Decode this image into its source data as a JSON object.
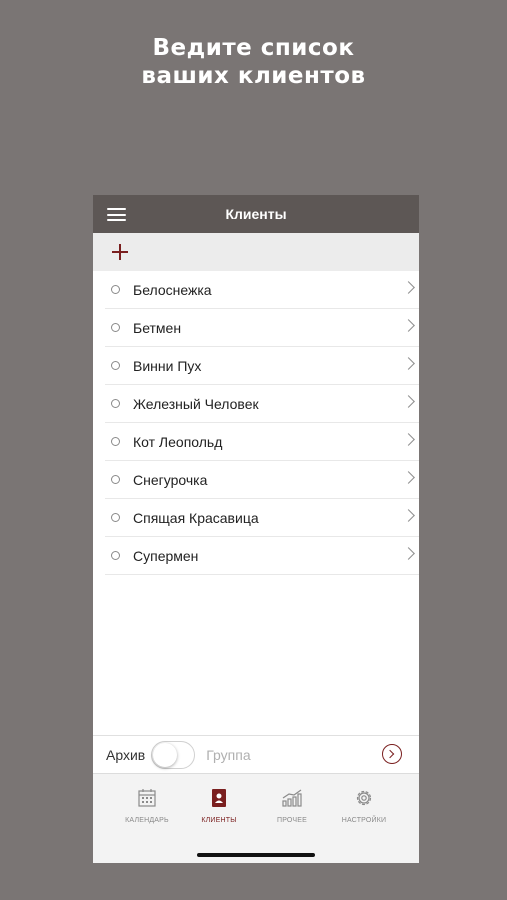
{
  "promo": {
    "line1": "Ведите список",
    "line2": "ваших клиентов"
  },
  "navbar": {
    "title": "Клиенты",
    "menu_icon": "hamburger-icon"
  },
  "addbar": {
    "add_symbol": "+",
    "add_icon": "plus-icon"
  },
  "clients": [
    {
      "name": "Белоснежка"
    },
    {
      "name": "Бетмен"
    },
    {
      "name": "Винни Пух"
    },
    {
      "name": "Железный Человек"
    },
    {
      "name": "Кот Леопольд"
    },
    {
      "name": "Снегурочка"
    },
    {
      "name": "Спящая Красавица"
    },
    {
      "name": "Супермен"
    }
  ],
  "controls": {
    "archive_label": "Архив",
    "group_label": "Группа",
    "archive_on": false
  },
  "tabs": [
    {
      "label": "КАЛЕНДАРЬ",
      "icon": "calendar-icon",
      "active": false
    },
    {
      "label": "КЛИЕНТЫ",
      "icon": "client-card-icon",
      "active": true
    },
    {
      "label": "ПРОЧЕЕ",
      "icon": "growth-chart-icon",
      "active": false
    },
    {
      "label": "НАСТРОЙКИ",
      "icon": "gear-icon",
      "active": false
    }
  ],
  "colors": {
    "background": "#7a7574",
    "navbar": "#5d5755",
    "accent": "#7a1f1f"
  }
}
